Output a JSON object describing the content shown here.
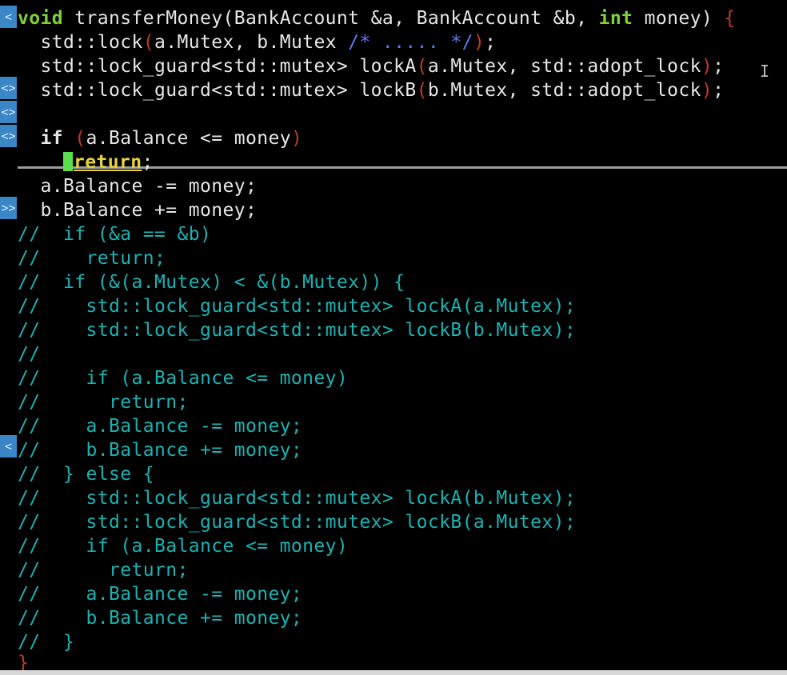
{
  "editor": {
    "lines": [
      "void transferMoney(BankAccount &a, BankAccount &b, int money) {",
      "  std::lock(a.Mutex, b.Mutex /* ..... */);",
      "  std::lock_guard<std::mutex> lockA(a.Mutex, std::adopt_lock);",
      "  std::lock_guard<std::mutex> lockB(b.Mutex, std::adopt_lock);",
      "",
      "  if (a.Balance <= money)",
      "    return;",
      "  a.Balance -= money;",
      "  b.Balance += money;",
      "//  if (&a == &b)",
      "//    return;",
      "//  if (&(a.Mutex) < &(b.Mutex)) {",
      "//    std::lock_guard<std::mutex> lockA(a.Mutex);",
      "//    std::lock_guard<std::mutex> lockB(b.Mutex);",
      "//",
      "//    if (a.Balance <= money)",
      "//      return;",
      "//    a.Balance -= money;",
      "//    b.Balance += money;",
      "//  } else {",
      "//    std::lock_guard<std::mutex> lockA(b.Mutex);",
      "//    std::lock_guard<std::mutex> lockB(a.Mutex);",
      "//    if (a.Balance <= money)",
      "//      return;",
      "//    a.Balance -= money;",
      "//    b.Balance += money;",
      "//  }",
      "}"
    ],
    "gutter_marks": [
      "<",
      "<>",
      "<>",
      "<>",
      ">>",
      "<"
    ],
    "colors": {
      "background": "#000000",
      "text": "#e6e6e6",
      "keyword_type": "#7dd23a",
      "paren": "#c03a26",
      "comment": "#1ab2b2",
      "block_comment": "#5a7cf0",
      "cursor": "#5ae04c",
      "gutter_mark": "#3a86c6",
      "split_line": "#9c9c9c"
    }
  }
}
